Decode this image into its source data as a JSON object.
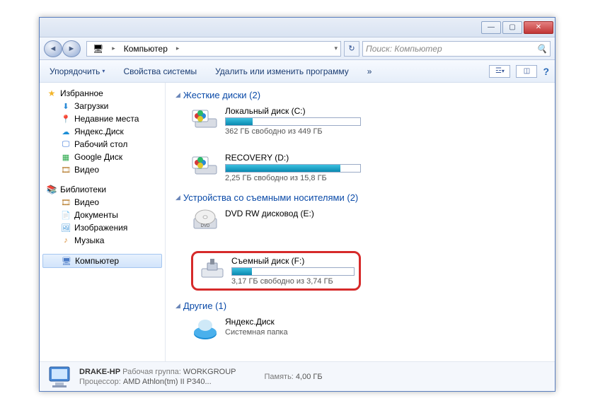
{
  "title_buttons": {
    "min": "—",
    "max": "▢",
    "close": "✕"
  },
  "nav": {
    "location_icon": "🖥",
    "location": "Компьютер",
    "search_placeholder": "Поиск: Компьютер"
  },
  "toolbar": {
    "organize": "Упорядочить",
    "properties": "Свойства системы",
    "uninstall": "Удалить или изменить программу",
    "more": "»",
    "help": "?"
  },
  "sidebar": {
    "favorites": {
      "title": "Избранное",
      "items": [
        {
          "icon": "⬇",
          "label": "Загрузки",
          "color": "#2a8ad6"
        },
        {
          "icon": "📍",
          "label": "Недавние места",
          "color": "#c76b2a"
        },
        {
          "icon": "☁",
          "label": "Яндекс.Диск",
          "color": "#1c8ed6"
        },
        {
          "icon": "🖵",
          "label": "Рабочий стол",
          "color": "#2a6ad6"
        },
        {
          "icon": "▦",
          "label": "Google Диск",
          "color": "#2aa84a"
        },
        {
          "icon": "🎞",
          "label": "Видео",
          "color": "#b57a2a"
        }
      ]
    },
    "libraries": {
      "title": "Библиотеки",
      "items": [
        {
          "icon": "🎞",
          "label": "Видео",
          "color": "#b57a2a"
        },
        {
          "icon": "📄",
          "label": "Документы",
          "color": "#d6a52a"
        },
        {
          "icon": "🖼",
          "label": "Изображения",
          "color": "#2a8ad6"
        },
        {
          "icon": "♪",
          "label": "Музыка",
          "color": "#d6852a"
        }
      ]
    },
    "computer": {
      "title": "Компьютер"
    }
  },
  "sections": {
    "hdd": {
      "title": "Жесткие диски (2)",
      "drives": [
        {
          "name": "Локальный диск (C:)",
          "free": "362 ГБ свободно из 449 ГБ",
          "fill": 20
        },
        {
          "name": "RECOVERY (D:)",
          "free": "2,25 ГБ свободно из 15,8 ГБ",
          "fill": 85
        }
      ]
    },
    "removable": {
      "title": "Устройства со съемными носителями (2)",
      "drives": [
        {
          "name": "DVD RW дисковод (E:)",
          "type": "dvd"
        },
        {
          "name": "Съемный диск (F:)",
          "free": "3,17 ГБ свободно из 3,74 ГБ",
          "fill": 16,
          "highlight": true
        }
      ]
    },
    "other": {
      "title": "Другие (1)",
      "drives": [
        {
          "name": "Яндекс.Диск",
          "sub": "Системная папка",
          "type": "yadisk"
        }
      ]
    }
  },
  "footer": {
    "pc": "DRAKE-HP",
    "workgroup_label": "Рабочая группа:",
    "workgroup": "WORKGROUP",
    "mem_label": "Память:",
    "mem": "4,00 ГБ",
    "cpu_label": "Процессор:",
    "cpu": "AMD Athlon(tm) II P340..."
  }
}
